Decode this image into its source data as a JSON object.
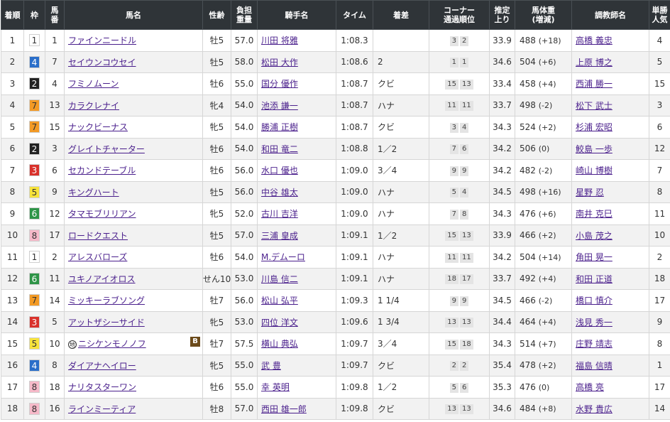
{
  "headers": {
    "rank": "着順",
    "waku": "枠",
    "umaban": "馬番",
    "horse": "馬名",
    "sexage": "性齢",
    "weight": "負担重量",
    "jockey": "騎手名",
    "time": "タイム",
    "margin": "着差",
    "corner": "コーナー通過順位",
    "last3f": "推定上り",
    "bodyweight": "馬体重(増減)",
    "trainer": "調教師名",
    "pop": "単勝人気"
  },
  "waku_colors": {
    "1": {
      "bg": "#ffffff",
      "fg": "#333333"
    },
    "2": {
      "bg": "#222222",
      "fg": "#ffffff"
    },
    "3": {
      "bg": "#d9312b",
      "fg": "#ffffff"
    },
    "4": {
      "bg": "#2a6ec9",
      "fg": "#ffffff"
    },
    "5": {
      "bg": "#f7e33a",
      "fg": "#333333"
    },
    "6": {
      "bg": "#2e9447",
      "fg": "#ffffff"
    },
    "7": {
      "bg": "#f39a25",
      "fg": "#333333"
    },
    "8": {
      "bg": "#f6b9c9",
      "fg": "#333333"
    }
  },
  "rows": [
    {
      "rank": "1",
      "waku": "1",
      "umaban": "1",
      "horse": "ファインニードル",
      "sexage": "牡5",
      "weight": "57.0",
      "jockey": "川田 将雅",
      "time": "1:08.3",
      "margin": "",
      "corner": [
        "3",
        "2"
      ],
      "last3f": "33.9",
      "bw": "488",
      "bwdiff": "(+18)",
      "trainer": "高橋 義忠",
      "pop": "4"
    },
    {
      "rank": "2",
      "waku": "4",
      "umaban": "7",
      "horse": "セイウンコウセイ",
      "sexage": "牡5",
      "weight": "58.0",
      "jockey": "松田 大作",
      "time": "1:08.6",
      "margin": "2",
      "corner": [
        "1",
        "1"
      ],
      "last3f": "34.6",
      "bw": "504",
      "bwdiff": "(+6)",
      "trainer": "上原 博之",
      "pop": "5"
    },
    {
      "rank": "3",
      "waku": "2",
      "umaban": "4",
      "horse": "フミノムーン",
      "sexage": "牡6",
      "weight": "55.0",
      "jockey": "国分 優作",
      "time": "1:08.7",
      "margin": "クビ",
      "corner": [
        "15",
        "13"
      ],
      "last3f": "33.4",
      "bw": "458",
      "bwdiff": "(+4)",
      "trainer": "西浦 勝一",
      "pop": "15"
    },
    {
      "rank": "4",
      "waku": "7",
      "umaban": "13",
      "horse": "カラクレナイ",
      "sexage": "牝4",
      "weight": "54.0",
      "jockey": "池添 謙一",
      "time": "1:08.7",
      "margin": "ハナ",
      "corner": [
        "11",
        "11"
      ],
      "last3f": "33.7",
      "bw": "498",
      "bwdiff": "(-2)",
      "trainer": "松下 武士",
      "pop": "3"
    },
    {
      "rank": "5",
      "waku": "7",
      "umaban": "15",
      "horse": "ナックビーナス",
      "sexage": "牝5",
      "weight": "54.0",
      "jockey": "勝浦 正樹",
      "time": "1:08.7",
      "margin": "クビ",
      "corner": [
        "3",
        "4"
      ],
      "last3f": "34.3",
      "bw": "524",
      "bwdiff": "(+2)",
      "trainer": "杉浦 宏昭",
      "pop": "6"
    },
    {
      "rank": "6",
      "waku": "2",
      "umaban": "3",
      "horse": "グレイトチャーター",
      "sexage": "牡6",
      "weight": "54.0",
      "jockey": "和田 竜二",
      "time": "1:08.8",
      "margin": "1／2",
      "corner": [
        "7",
        "6"
      ],
      "last3f": "34.2",
      "bw": "506",
      "bwdiff": "(0)",
      "trainer": "鮫島 一歩",
      "pop": "12"
    },
    {
      "rank": "7",
      "waku": "3",
      "umaban": "6",
      "horse": "セカンドテーブル",
      "sexage": "牡6",
      "weight": "56.0",
      "jockey": "水口 優也",
      "time": "1:09.0",
      "margin": "3／4",
      "corner": [
        "9",
        "9"
      ],
      "last3f": "34.2",
      "bw": "482",
      "bwdiff": "(-2)",
      "trainer": "崎山 博樹",
      "pop": "7"
    },
    {
      "rank": "8",
      "waku": "5",
      "umaban": "9",
      "horse": "キングハート",
      "sexage": "牡5",
      "weight": "56.0",
      "jockey": "中谷 雄太",
      "time": "1:09.0",
      "margin": "ハナ",
      "corner": [
        "5",
        "4"
      ],
      "last3f": "34.5",
      "bw": "498",
      "bwdiff": "(+16)",
      "trainer": "星野 忍",
      "pop": "8"
    },
    {
      "rank": "9",
      "waku": "6",
      "umaban": "12",
      "horse": "タマモブリリアン",
      "sexage": "牝5",
      "weight": "52.0",
      "jockey": "古川 吉洋",
      "time": "1:09.0",
      "margin": "ハナ",
      "corner": [
        "7",
        "8"
      ],
      "last3f": "34.3",
      "bw": "476",
      "bwdiff": "(+6)",
      "trainer": "南井 克巳",
      "pop": "11"
    },
    {
      "rank": "10",
      "waku": "8",
      "umaban": "17",
      "horse": "ロードクエスト",
      "sexage": "牡5",
      "weight": "57.0",
      "jockey": "三浦 皇成",
      "time": "1:09.1",
      "margin": "1／2",
      "corner": [
        "15",
        "13"
      ],
      "last3f": "33.9",
      "bw": "466",
      "bwdiff": "(+2)",
      "trainer": "小島 茂之",
      "pop": "10"
    },
    {
      "rank": "11",
      "waku": "1",
      "umaban": "2",
      "horse": "アレスバローズ",
      "sexage": "牡6",
      "weight": "54.0",
      "jockey": "M.デムーロ",
      "time": "1:09.1",
      "margin": "ハナ",
      "corner": [
        "11",
        "11"
      ],
      "last3f": "34.2",
      "bw": "504",
      "bwdiff": "(+14)",
      "trainer": "角田 晃一",
      "pop": "2"
    },
    {
      "rank": "12",
      "waku": "6",
      "umaban": "11",
      "horse": "ユキノアイオロス",
      "sexage": "せん10",
      "weight": "53.0",
      "jockey": "川島 信二",
      "time": "1:09.1",
      "margin": "ハナ",
      "corner": [
        "18",
        "17"
      ],
      "last3f": "33.7",
      "bw": "492",
      "bwdiff": "(+4)",
      "trainer": "和田 正道",
      "pop": "18"
    },
    {
      "rank": "13",
      "waku": "7",
      "umaban": "14",
      "horse": "ミッキーラブソング",
      "sexage": "牡7",
      "weight": "56.0",
      "jockey": "松山 弘平",
      "time": "1:09.3",
      "margin": "1 1/4",
      "corner": [
        "9",
        "9"
      ],
      "last3f": "34.5",
      "bw": "466",
      "bwdiff": "(-2)",
      "trainer": "橋口 慎介",
      "pop": "17"
    },
    {
      "rank": "14",
      "waku": "3",
      "umaban": "5",
      "horse": "アットザシーサイド",
      "sexage": "牝5",
      "weight": "53.0",
      "jockey": "四位 洋文",
      "time": "1:09.6",
      "margin": "1 3/4",
      "corner": [
        "13",
        "13"
      ],
      "last3f": "34.4",
      "bw": "464",
      "bwdiff": "(+4)",
      "trainer": "浅見 秀一",
      "pop": "9"
    },
    {
      "rank": "15",
      "waku": "5",
      "umaban": "10",
      "horse": "ニシケンモノノフ",
      "chiho": "地",
      "blinker": "B",
      "sexage": "牡7",
      "weight": "57.5",
      "jockey": "横山 典弘",
      "time": "1:09.7",
      "margin": "3／4",
      "corner": [
        "15",
        "18"
      ],
      "last3f": "34.3",
      "bw": "514",
      "bwdiff": "(+7)",
      "trainer": "庄野 靖志",
      "pop": "8"
    },
    {
      "rank": "16",
      "waku": "4",
      "umaban": "8",
      "horse": "ダイアナヘイロー",
      "sexage": "牝5",
      "weight": "55.0",
      "jockey": "武 豊",
      "time": "1:09.7",
      "margin": "クビ",
      "corner": [
        "2",
        "2"
      ],
      "last3f": "35.4",
      "bw": "478",
      "bwdiff": "(+2)",
      "trainer": "福島 信晴",
      "pop": "1"
    },
    {
      "rank": "17",
      "waku": "8",
      "umaban": "18",
      "horse": "ナリタスターワン",
      "sexage": "牡6",
      "weight": "55.0",
      "jockey": "幸 英明",
      "time": "1:09.8",
      "margin": "1／2",
      "corner": [
        "5",
        "6"
      ],
      "last3f": "35.3",
      "bw": "476",
      "bwdiff": "(0)",
      "trainer": "高橋 亮",
      "pop": "17"
    },
    {
      "rank": "18",
      "waku": "8",
      "umaban": "16",
      "horse": "ラインミーティア",
      "sexage": "牡8",
      "weight": "57.0",
      "jockey": "西田 雄一郎",
      "time": "1:09.8",
      "margin": "クビ",
      "corner": [
        "13",
        "13"
      ],
      "last3f": "34.6",
      "bw": "484",
      "bwdiff": "(+8)",
      "trainer": "水野 貴広",
      "pop": "14"
    }
  ]
}
